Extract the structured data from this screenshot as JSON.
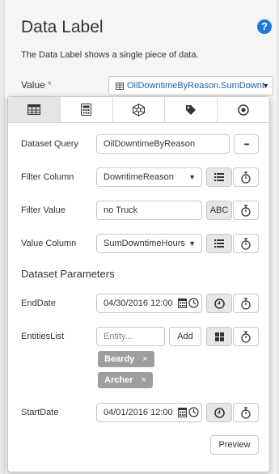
{
  "header": {
    "title": "Data Label",
    "help_glyph": "?",
    "description": "The Data Label shows a single piece of data.",
    "value_label": "Value",
    "required_mark": "*",
    "value_selected": "OilDowntimeByReason.SumDowntimeHours"
  },
  "tabs": [
    {
      "name": "dataset-icon",
      "active": true
    },
    {
      "name": "calculator-icon",
      "active": false
    },
    {
      "name": "network-icon",
      "active": false
    },
    {
      "name": "tag-icon",
      "active": false
    },
    {
      "name": "target-icon",
      "active": false
    }
  ],
  "form": {
    "dataset_query_label": "Dataset Query",
    "dataset_query_value": "OilDowntimeByReason",
    "more_glyph": "•••",
    "filter_column_label": "Filter Column",
    "filter_column_value": "DowntimeReason",
    "filter_value_label": "Filter Value",
    "filter_value_value": "no Truck",
    "abc_label": "ABC",
    "value_column_label": "Value Column",
    "value_column_value": "SumDowntimeHours",
    "params_title": "Dataset Parameters",
    "enddate_label": "EndDate",
    "enddate_value": "04/30/2016 12:00",
    "entities_label": "EntitiesList",
    "entity_placeholder": "Entity...",
    "add_label": "Add",
    "entities": [
      "Beardy",
      "Archer"
    ],
    "chip_remove": "×",
    "startdate_label": "StartDate",
    "startdate_value": "04/01/2016 12:00",
    "preview_label": "Preview"
  },
  "colors": {
    "accent": "#1f7ad6",
    "required": "#d9534f",
    "chip": "#9e9e9e",
    "link": "#1f5fa8"
  }
}
